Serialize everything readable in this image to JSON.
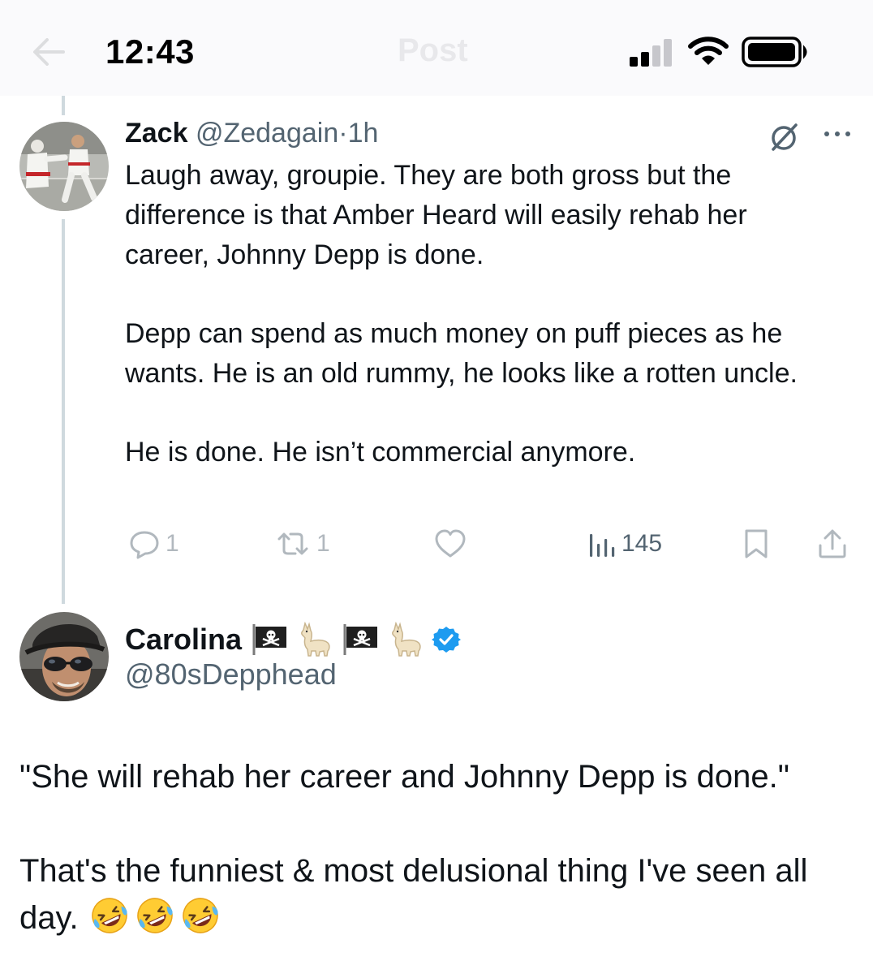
{
  "status_bar": {
    "time": "12:43",
    "ghost_title": "Post"
  },
  "tweet": {
    "author_name": "Zack",
    "handle": "@Zedagain",
    "separator": "·",
    "time_ago": "1h",
    "paragraphs": [
      "Laugh away, groupie. They are both gross but the difference is that Amber Heard will easily rehab her career, Johnny Depp is done.",
      "Depp can spend as much money on puff pieces as he wants. He is an old rummy, he looks like a rotten uncle.",
      "He is done. He isn’t commercial anymore."
    ],
    "actions": {
      "replies": "1",
      "reposts": "1",
      "views": "145"
    }
  },
  "reply": {
    "author_name": "Carolina",
    "name_emojis": [
      "pirate-flag",
      "llama",
      "pirate-flag",
      "llama"
    ],
    "verified": true,
    "handle": "@80sDepphead",
    "paragraphs": [
      "\"She will rehab her career and Johnny Depp is done.\"",
      "That's the funniest  & most delusional thing I've seen all day."
    ],
    "trailing_emojis": [
      "rolling-on-floor-laughing",
      "rolling-on-floor-laughing",
      "rolling-on-floor-laughing"
    ]
  },
  "colors": {
    "text": "#0f1419",
    "muted": "#536471",
    "thread_line": "#cfd9de",
    "verified_blue": "#1d9bf0",
    "status_bar_bg": "#fafafc"
  }
}
